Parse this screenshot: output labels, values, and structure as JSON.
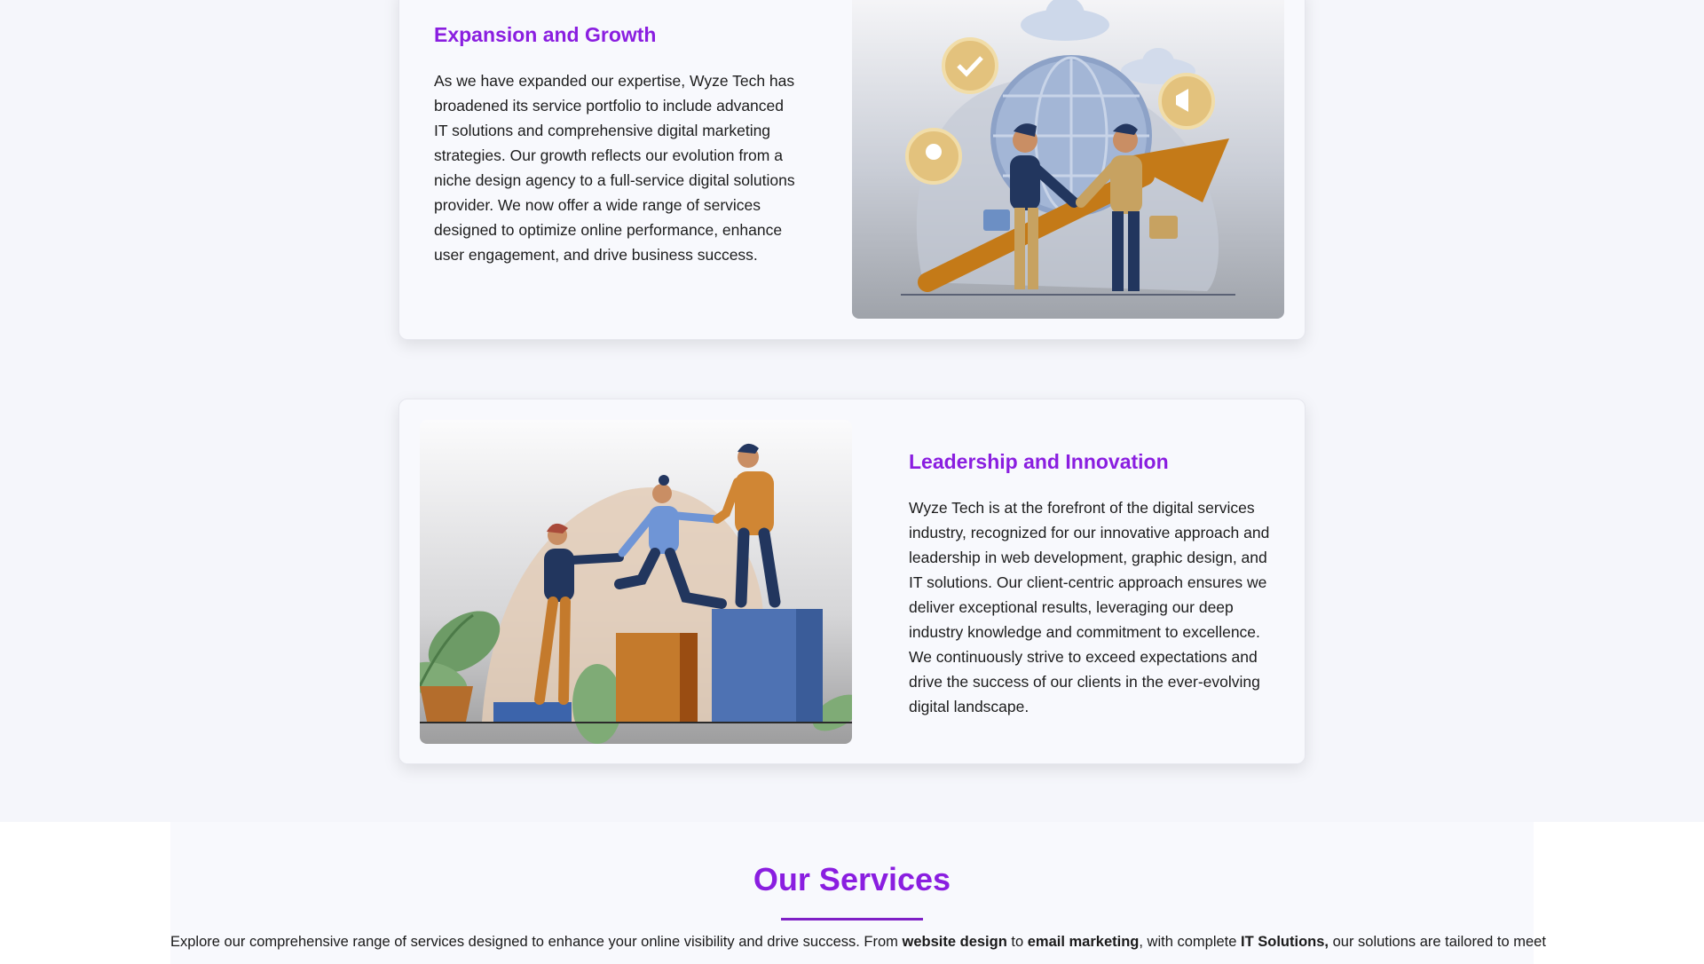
{
  "sections": [
    {
      "title": "Expansion and Growth",
      "body": "As we have expanded our expertise, Wyze Tech has broadened its service portfolio to include advanced IT solutions and comprehensive digital marketing strategies. Our growth reflects our evolution from a niche design agency to a full-service digital solutions provider. We now offer a wide range of services designed to optimize online performance, enhance user engagement, and drive business success."
    },
    {
      "title": "Leadership and Innovation",
      "body": "Wyze Tech is at the forefront of the digital services industry, recognized for our innovative approach and leadership in web development, graphic design, and IT solutions. Our client-centric approach ensures we deliver exceptional results, leveraging our deep industry knowledge and commitment to excellence. We continuously strive to exceed expectations and drive the success of our clients in the ever-evolving digital landscape."
    }
  ],
  "services": {
    "title": "Our Services",
    "intro_1": "Explore our comprehensive range of services designed to enhance your online visibility and drive success. From ",
    "bold_1": "website design",
    "intro_2": " to ",
    "bold_2": "email marketing",
    "intro_3": ", with complete ",
    "bold_3": "IT Solutions,",
    "intro_4": " our solutions are tailored to meet"
  },
  "colors": {
    "accent": "#8a1ee0",
    "background": "#f5f6fb"
  }
}
